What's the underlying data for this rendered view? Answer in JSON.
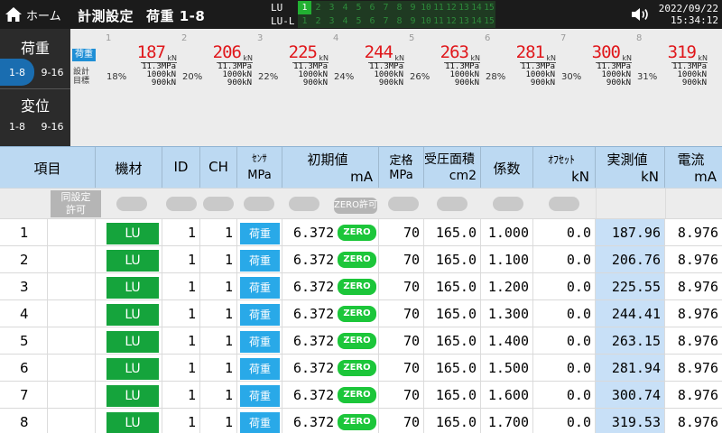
{
  "topbar": {
    "home_label": "ホーム",
    "title": "計測設定",
    "subtitle": "荷重 1-8",
    "lu_tag": "LU",
    "lul_tag": "LU-L",
    "channels": [
      "1",
      "2",
      "3",
      "4",
      "5",
      "6",
      "7",
      "8",
      "9",
      "10",
      "11",
      "12",
      "13",
      "14",
      "15"
    ],
    "lu_active": 1,
    "date": "2022/09/22",
    "time": "15:34:12"
  },
  "sidebar": {
    "load_title": "荷重",
    "load_range_a": "1-8",
    "load_range_b": "9-16",
    "disp_title": "変位",
    "disp_range_a": "1-8",
    "disp_range_b": "9-16"
  },
  "summary": {
    "badge": "荷重",
    "label_design": "設計",
    "label_target": "目標",
    "unit": "kN",
    "columns": [
      {
        "idx": "1",
        "value": "187",
        "pct": "18%",
        "p1": "11.3MPa",
        "p2": "1000kN",
        "p3": "900kN"
      },
      {
        "idx": "2",
        "value": "206",
        "pct": "20%",
        "p1": "11.3MPa",
        "p2": "1000kN",
        "p3": "900kN"
      },
      {
        "idx": "3",
        "value": "225",
        "pct": "22%",
        "p1": "11.3MPa",
        "p2": "1000kN",
        "p3": "900kN"
      },
      {
        "idx": "4",
        "value": "244",
        "pct": "24%",
        "p1": "11.3MPa",
        "p2": "1000kN",
        "p3": "900kN"
      },
      {
        "idx": "5",
        "value": "263",
        "pct": "26%",
        "p1": "11.3MPa",
        "p2": "1000kN",
        "p3": "900kN"
      },
      {
        "idx": "6",
        "value": "281",
        "pct": "28%",
        "p1": "11.3MPa",
        "p2": "1000kN",
        "p3": "900kN"
      },
      {
        "idx": "7",
        "value": "300",
        "pct": "30%",
        "p1": "11.3MPa",
        "p2": "1000kN",
        "p3": "900kN"
      },
      {
        "idx": "8",
        "value": "319",
        "pct": "31%",
        "p1": "11.3MPa",
        "p2": "1000kN",
        "p3": "900kN"
      }
    ]
  },
  "table": {
    "headers": {
      "item": "項目",
      "equipment": "機材",
      "id": "ID",
      "ch": "CH",
      "sensor_top": "ｾﾝｻ",
      "sensor_unit": "MPa",
      "initial": "初期値",
      "initial_unit": "mA",
      "rated_top": "定格",
      "rated_unit": "MPa",
      "area": "受圧面積",
      "area_unit": "cm2",
      "coef": "係数",
      "offset_top": "ｵﾌｾｯﾄ",
      "offset_unit": "kN",
      "measured": "実測値",
      "measured_unit": "kN",
      "current": "電流",
      "current_unit": "mA"
    },
    "same_setting_label_1": "同設定",
    "same_setting_label_2": "許可",
    "zero_allow_label": "ZERO許可",
    "rows": [
      {
        "item": "1",
        "equip": "LU",
        "id": "1",
        "ch": "1",
        "sensor": "荷重",
        "initial": "6.372",
        "zero": "ZERO",
        "rated": "70",
        "area": "165.0",
        "coef": "1.000",
        "offset": "0.0",
        "measured": "187.96",
        "current": "8.976"
      },
      {
        "item": "2",
        "equip": "LU",
        "id": "1",
        "ch": "1",
        "sensor": "荷重",
        "initial": "6.372",
        "zero": "ZERO",
        "rated": "70",
        "area": "165.0",
        "coef": "1.100",
        "offset": "0.0",
        "measured": "206.76",
        "current": "8.976"
      },
      {
        "item": "3",
        "equip": "LU",
        "id": "1",
        "ch": "1",
        "sensor": "荷重",
        "initial": "6.372",
        "zero": "ZERO",
        "rated": "70",
        "area": "165.0",
        "coef": "1.200",
        "offset": "0.0",
        "measured": "225.55",
        "current": "8.976"
      },
      {
        "item": "4",
        "equip": "LU",
        "id": "1",
        "ch": "1",
        "sensor": "荷重",
        "initial": "6.372",
        "zero": "ZERO",
        "rated": "70",
        "area": "165.0",
        "coef": "1.300",
        "offset": "0.0",
        "measured": "244.41",
        "current": "8.976"
      },
      {
        "item": "5",
        "equip": "LU",
        "id": "1",
        "ch": "1",
        "sensor": "荷重",
        "initial": "6.372",
        "zero": "ZERO",
        "rated": "70",
        "area": "165.0",
        "coef": "1.400",
        "offset": "0.0",
        "measured": "263.15",
        "current": "8.976"
      },
      {
        "item": "6",
        "equip": "LU",
        "id": "1",
        "ch": "1",
        "sensor": "荷重",
        "initial": "6.372",
        "zero": "ZERO",
        "rated": "70",
        "area": "165.0",
        "coef": "1.500",
        "offset": "0.0",
        "measured": "281.94",
        "current": "8.976"
      },
      {
        "item": "7",
        "equip": "LU",
        "id": "1",
        "ch": "1",
        "sensor": "荷重",
        "initial": "6.372",
        "zero": "ZERO",
        "rated": "70",
        "area": "165.0",
        "coef": "1.600",
        "offset": "0.0",
        "measured": "300.74",
        "current": "8.976"
      },
      {
        "item": "8",
        "equip": "LU",
        "id": "1",
        "ch": "1",
        "sensor": "荷重",
        "initial": "6.372",
        "zero": "ZERO",
        "rated": "70",
        "area": "165.0",
        "coef": "1.700",
        "offset": "0.0",
        "measured": "319.53",
        "current": "8.976"
      }
    ]
  }
}
